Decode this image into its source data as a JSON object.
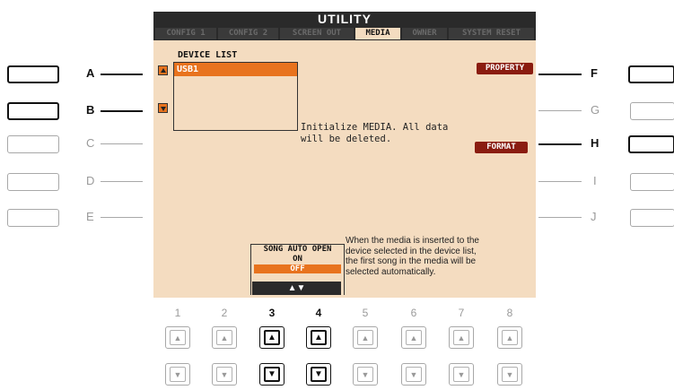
{
  "screen": {
    "title": "UTILITY",
    "tabs": [
      "CONFIG 1",
      "CONFIG 2",
      "SCREEN OUT",
      "MEDIA",
      "OWNER",
      "SYSTEM RESET"
    ],
    "active_tab": "MEDIA",
    "device_list_label": "DEVICE LIST",
    "devices": [
      "USB1"
    ],
    "initialize_message_line1": "Initialize MEDIA. All data",
    "initialize_message_line2": "will be deleted.",
    "property_button": "PROPERTY",
    "format_button": "FORMAT",
    "song_auto_open_label": "SONG AUTO OPEN",
    "song_auto_open_on": "ON",
    "song_auto_open_off": "OFF",
    "song_auto_open_arrows": "▲▼",
    "auto_open_message": [
      "When the media is inserted to the",
      "device selected in the device list,",
      "the first song in the media will be",
      "selected automatically."
    ]
  },
  "left_buttons": [
    {
      "letter": "A",
      "active": true
    },
    {
      "letter": "B",
      "active": true
    },
    {
      "letter": "C",
      "active": false
    },
    {
      "letter": "D",
      "active": false
    },
    {
      "letter": "E",
      "active": false
    }
  ],
  "right_buttons": [
    {
      "letter": "F",
      "active": true
    },
    {
      "letter": "G",
      "active": false
    },
    {
      "letter": "H",
      "active": true
    },
    {
      "letter": "I",
      "active": false
    },
    {
      "letter": "J",
      "active": false
    }
  ],
  "bottom_buttons": [
    {
      "number": "1",
      "active": false
    },
    {
      "number": "2",
      "active": false
    },
    {
      "number": "3",
      "active": true
    },
    {
      "number": "4",
      "active": true
    },
    {
      "number": "5",
      "active": false
    },
    {
      "number": "6",
      "active": false
    },
    {
      "number": "7",
      "active": false
    },
    {
      "number": "8",
      "active": false
    }
  ],
  "arrow_up": "▲",
  "arrow_down": "▼",
  "colors": {
    "lcd_background": "#f4dcc0",
    "highlight_orange": "#e8731e",
    "button_red": "#8a1c10",
    "bar_dark": "#2a2a2a"
  }
}
